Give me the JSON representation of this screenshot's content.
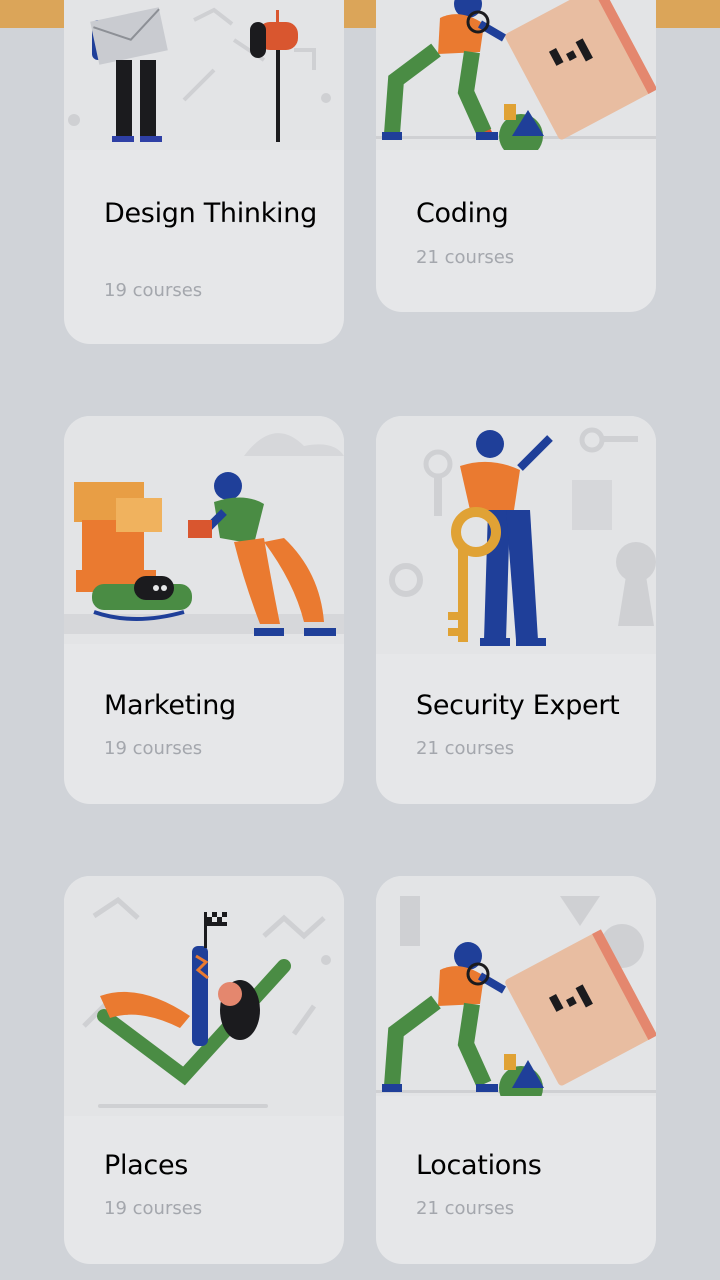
{
  "colors": {
    "background": "#d0d3d8",
    "card": "#e6e7e9",
    "accent_strip": "#dba559",
    "title": "#000000",
    "meta": "#a4a7ad"
  },
  "categories": [
    {
      "title": "Design Thinking",
      "courses": "19 courses",
      "illustration": "person-with-mailbox-illustration"
    },
    {
      "title": "Coding",
      "courses": "21 courses",
      "illustration": "person-with-magnifier-book-illustration"
    },
    {
      "title": "Marketing",
      "courses": "19 courses",
      "illustration": "person-with-drone-boxes-illustration"
    },
    {
      "title": "Security Expert",
      "courses": "21 courses",
      "illustration": "person-holding-key-illustration"
    },
    {
      "title": "Places",
      "courses": "19 courses",
      "illustration": "person-with-flag-illustration"
    },
    {
      "title": "Locations",
      "courses": "21 courses",
      "illustration": "person-with-magnifier-book-illustration"
    }
  ]
}
